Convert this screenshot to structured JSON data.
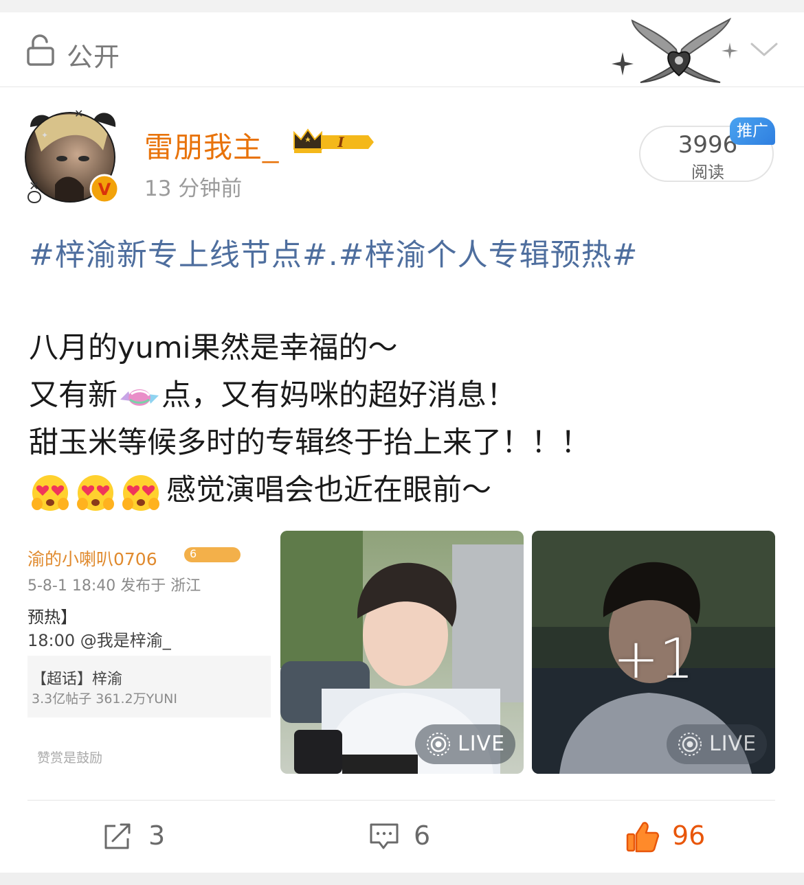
{
  "header": {
    "privacy_label": "公开",
    "icons": [
      "lock-icon",
      "decoration-sticker",
      "chevron-down-icon"
    ]
  },
  "post": {
    "username": "雷朋我主_",
    "vip_level": "I",
    "timestamp": "13 分钟前",
    "reads": "3996",
    "reads_label": "阅读",
    "promo_tag": "推广",
    "hashtags": "#梓渝新专上线节点#.#梓渝个人专辑预热#",
    "lines": [
      "八月的yumi果然是幸福的～",
      "又有新",
      "点，又有妈咪的超好消息！",
      "甜玉米等候多时的专辑终于抬上来了！！！",
      "感觉演唱会也近在眼前～"
    ],
    "emoji": [
      "candy-emoji",
      "heart-eyes-emoji"
    ]
  },
  "images": {
    "screenshot": {
      "name": "渝的小喇叭0706",
      "badge": "6",
      "date": "5-8-1 18:40  发布于 浙江",
      "tag": "预热】",
      "mention": "18:00 @我是梓渝_",
      "topic": "【超话】梓渝",
      "stats": "3.3亿帖子 361.2万YUNI",
      "footer": "赞赏是鼓励"
    },
    "live_label": "LIVE",
    "more_count": "+1"
  },
  "actions": {
    "repost_count": "3",
    "comment_count": "6",
    "like_count": "96"
  },
  "colors": {
    "username": "#e8730a",
    "hashtag": "#4e6e9e",
    "like": "#e8560a",
    "promo": "#2f7fe0"
  }
}
